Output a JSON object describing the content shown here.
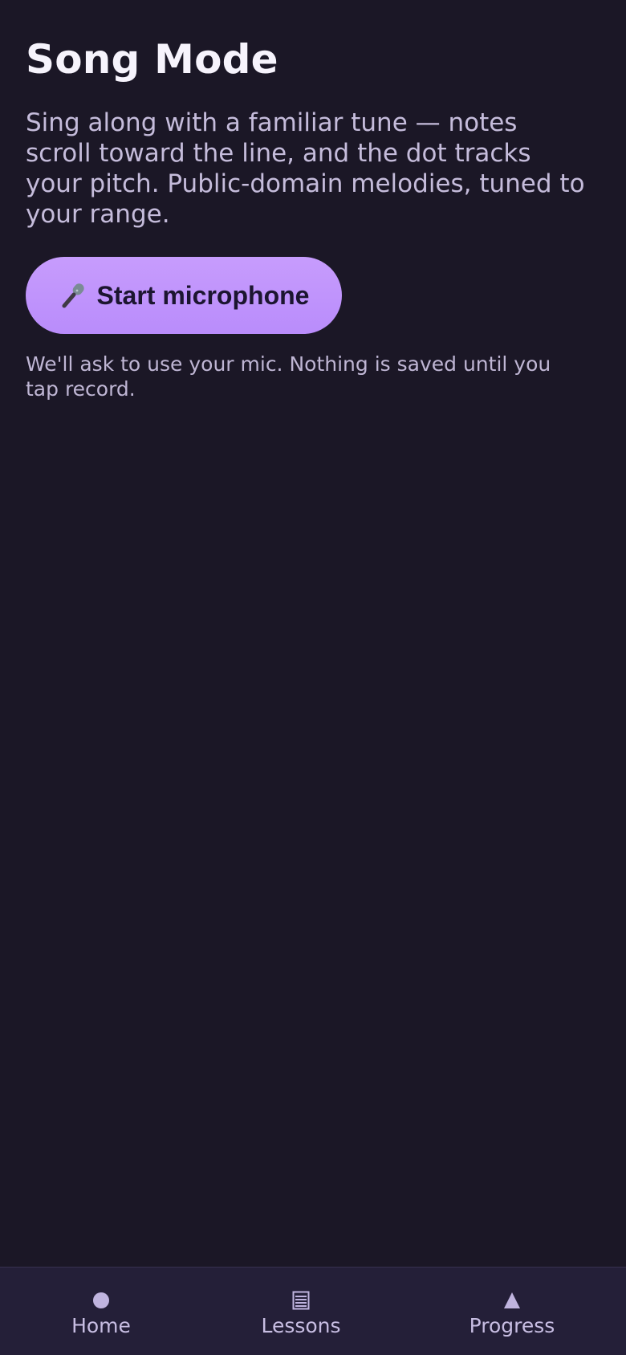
{
  "page": {
    "title": "Song Mode",
    "intro": "Sing along with a familiar tune — notes scroll toward the line, and the dot tracks your pitch. Public-domain melodies, tuned to your range.",
    "start_button_label": "Start microphone",
    "start_button_icon": "microphone-icon",
    "mic_note": "We'll ask to use your mic. Nothing is saved until you tap record."
  },
  "tabbar": {
    "items": [
      {
        "label": "Home",
        "icon": "home-dot-icon"
      },
      {
        "label": "Lessons",
        "icon": "lessons-list-icon"
      },
      {
        "label": "Progress",
        "icon": "progress-triangle-icon"
      }
    ]
  },
  "colors": {
    "background": "#1b1726",
    "accent": "#c79cfd",
    "tabbar": "#241f38",
    "muted_text": "#c5bcdb"
  }
}
